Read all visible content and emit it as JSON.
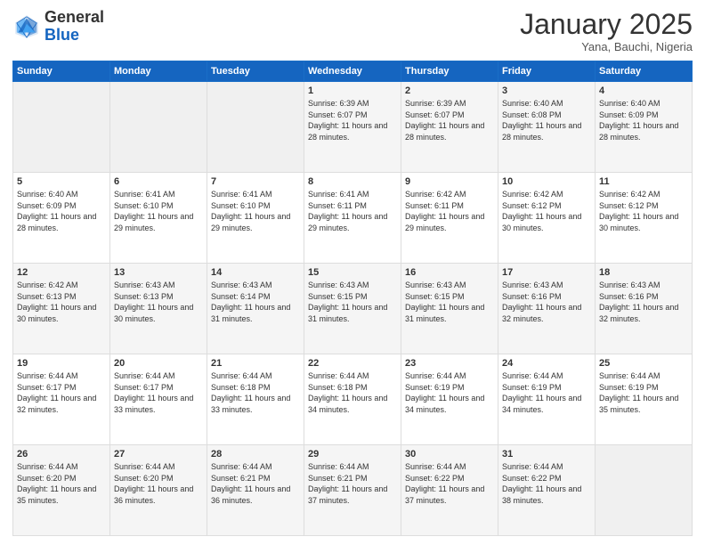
{
  "logo": {
    "general": "General",
    "blue": "Blue"
  },
  "header": {
    "month": "January 2025",
    "location": "Yana, Bauchi, Nigeria"
  },
  "days_of_week": [
    "Sunday",
    "Monday",
    "Tuesday",
    "Wednesday",
    "Thursday",
    "Friday",
    "Saturday"
  ],
  "weeks": [
    [
      {
        "day": "",
        "info": ""
      },
      {
        "day": "",
        "info": ""
      },
      {
        "day": "",
        "info": ""
      },
      {
        "day": "1",
        "info": "Sunrise: 6:39 AM\nSunset: 6:07 PM\nDaylight: 11 hours and 28 minutes."
      },
      {
        "day": "2",
        "info": "Sunrise: 6:39 AM\nSunset: 6:07 PM\nDaylight: 11 hours and 28 minutes."
      },
      {
        "day": "3",
        "info": "Sunrise: 6:40 AM\nSunset: 6:08 PM\nDaylight: 11 hours and 28 minutes."
      },
      {
        "day": "4",
        "info": "Sunrise: 6:40 AM\nSunset: 6:09 PM\nDaylight: 11 hours and 28 minutes."
      }
    ],
    [
      {
        "day": "5",
        "info": "Sunrise: 6:40 AM\nSunset: 6:09 PM\nDaylight: 11 hours and 28 minutes."
      },
      {
        "day": "6",
        "info": "Sunrise: 6:41 AM\nSunset: 6:10 PM\nDaylight: 11 hours and 29 minutes."
      },
      {
        "day": "7",
        "info": "Sunrise: 6:41 AM\nSunset: 6:10 PM\nDaylight: 11 hours and 29 minutes."
      },
      {
        "day": "8",
        "info": "Sunrise: 6:41 AM\nSunset: 6:11 PM\nDaylight: 11 hours and 29 minutes."
      },
      {
        "day": "9",
        "info": "Sunrise: 6:42 AM\nSunset: 6:11 PM\nDaylight: 11 hours and 29 minutes."
      },
      {
        "day": "10",
        "info": "Sunrise: 6:42 AM\nSunset: 6:12 PM\nDaylight: 11 hours and 30 minutes."
      },
      {
        "day": "11",
        "info": "Sunrise: 6:42 AM\nSunset: 6:12 PM\nDaylight: 11 hours and 30 minutes."
      }
    ],
    [
      {
        "day": "12",
        "info": "Sunrise: 6:42 AM\nSunset: 6:13 PM\nDaylight: 11 hours and 30 minutes."
      },
      {
        "day": "13",
        "info": "Sunrise: 6:43 AM\nSunset: 6:13 PM\nDaylight: 11 hours and 30 minutes."
      },
      {
        "day": "14",
        "info": "Sunrise: 6:43 AM\nSunset: 6:14 PM\nDaylight: 11 hours and 31 minutes."
      },
      {
        "day": "15",
        "info": "Sunrise: 6:43 AM\nSunset: 6:15 PM\nDaylight: 11 hours and 31 minutes."
      },
      {
        "day": "16",
        "info": "Sunrise: 6:43 AM\nSunset: 6:15 PM\nDaylight: 11 hours and 31 minutes."
      },
      {
        "day": "17",
        "info": "Sunrise: 6:43 AM\nSunset: 6:16 PM\nDaylight: 11 hours and 32 minutes."
      },
      {
        "day": "18",
        "info": "Sunrise: 6:43 AM\nSunset: 6:16 PM\nDaylight: 11 hours and 32 minutes."
      }
    ],
    [
      {
        "day": "19",
        "info": "Sunrise: 6:44 AM\nSunset: 6:17 PM\nDaylight: 11 hours and 32 minutes."
      },
      {
        "day": "20",
        "info": "Sunrise: 6:44 AM\nSunset: 6:17 PM\nDaylight: 11 hours and 33 minutes."
      },
      {
        "day": "21",
        "info": "Sunrise: 6:44 AM\nSunset: 6:18 PM\nDaylight: 11 hours and 33 minutes."
      },
      {
        "day": "22",
        "info": "Sunrise: 6:44 AM\nSunset: 6:18 PM\nDaylight: 11 hours and 34 minutes."
      },
      {
        "day": "23",
        "info": "Sunrise: 6:44 AM\nSunset: 6:19 PM\nDaylight: 11 hours and 34 minutes."
      },
      {
        "day": "24",
        "info": "Sunrise: 6:44 AM\nSunset: 6:19 PM\nDaylight: 11 hours and 34 minutes."
      },
      {
        "day": "25",
        "info": "Sunrise: 6:44 AM\nSunset: 6:19 PM\nDaylight: 11 hours and 35 minutes."
      }
    ],
    [
      {
        "day": "26",
        "info": "Sunrise: 6:44 AM\nSunset: 6:20 PM\nDaylight: 11 hours and 35 minutes."
      },
      {
        "day": "27",
        "info": "Sunrise: 6:44 AM\nSunset: 6:20 PM\nDaylight: 11 hours and 36 minutes."
      },
      {
        "day": "28",
        "info": "Sunrise: 6:44 AM\nSunset: 6:21 PM\nDaylight: 11 hours and 36 minutes."
      },
      {
        "day": "29",
        "info": "Sunrise: 6:44 AM\nSunset: 6:21 PM\nDaylight: 11 hours and 37 minutes."
      },
      {
        "day": "30",
        "info": "Sunrise: 6:44 AM\nSunset: 6:22 PM\nDaylight: 11 hours and 37 minutes."
      },
      {
        "day": "31",
        "info": "Sunrise: 6:44 AM\nSunset: 6:22 PM\nDaylight: 11 hours and 38 minutes."
      },
      {
        "day": "",
        "info": ""
      }
    ]
  ]
}
